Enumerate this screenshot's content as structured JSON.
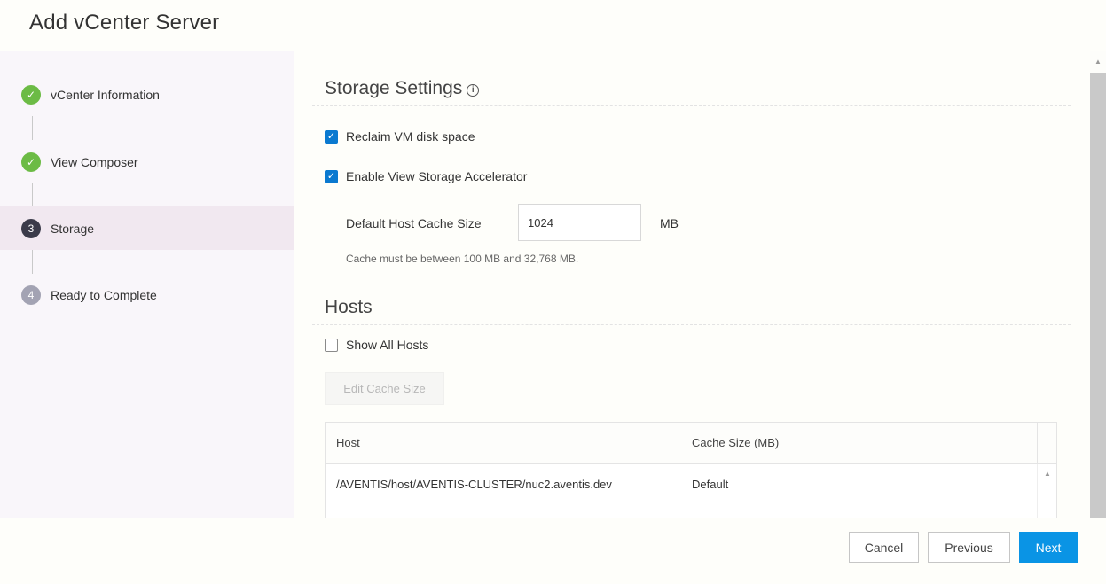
{
  "dialog": {
    "title": "Add vCenter Server"
  },
  "steps": [
    {
      "number": "✓",
      "label": "vCenter Information",
      "state": "done"
    },
    {
      "number": "✓",
      "label": "View Composer",
      "state": "done"
    },
    {
      "number": "3",
      "label": "Storage",
      "state": "current"
    },
    {
      "number": "4",
      "label": "Ready to Complete",
      "state": "pending"
    }
  ],
  "storage": {
    "title": "Storage Settings",
    "info_glyph": "i",
    "reclaim_label": "Reclaim VM disk space",
    "reclaim_checked": true,
    "accelerator_label": "Enable View Storage Accelerator",
    "accelerator_checked": true,
    "cache_label": "Default Host Cache Size",
    "cache_value": "1024",
    "cache_unit": "MB",
    "cache_hint": "Cache must be between 100 MB and 32,768 MB."
  },
  "hosts": {
    "title": "Hosts",
    "show_all_label": "Show All Hosts",
    "show_all_checked": false,
    "edit_button": "Edit Cache Size",
    "columns": [
      "Host",
      "Cache Size (MB)"
    ],
    "rows": [
      {
        "host": "/AVENTIS/host/AVENTIS-CLUSTER/nuc2.aventis.dev",
        "cache": "Default"
      }
    ]
  },
  "footer": {
    "cancel": "Cancel",
    "previous": "Previous",
    "next": "Next"
  },
  "colors": {
    "done": "#6cbb45",
    "current": "#3b3b4a",
    "pending": "#a3a3b3",
    "primary": "#0a94e5",
    "checkbox": "#0a79d0"
  }
}
